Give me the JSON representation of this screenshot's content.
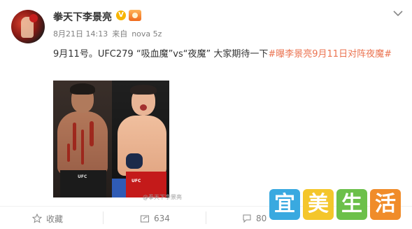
{
  "post": {
    "username": "拳天下李景亮",
    "verified_badge": "V",
    "date": "8月21日 14:13",
    "source_prefix": "来自",
    "source_device": "nova 5z",
    "text_plain": "9月11号。UFC279 “吸血魔”vs“夜魔” 大家期待一下",
    "topic": "#曝李景亮9月11日对阵夜魔#",
    "photo_watermark": "@拳天下李景亮"
  },
  "actions": {
    "favorite_label": "收藏",
    "share_count": "634",
    "comment_count": "80",
    "favorite_icon": "star-icon",
    "share_icon": "share-icon",
    "comment_icon": "comment-icon"
  },
  "watermark": {
    "chars": [
      "宜",
      "美",
      "生",
      "活"
    ],
    "colors": [
      "#39a9e0",
      "#f4c62b",
      "#6cc04a",
      "#f08c2a"
    ]
  },
  "icons": {
    "more": "chevron-down-icon",
    "verified": "verified-v-icon",
    "level": "level-badge-icon"
  }
}
